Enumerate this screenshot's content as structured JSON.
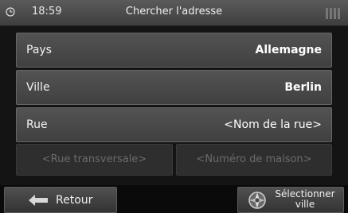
{
  "status": {
    "time": "18:59",
    "title": "Chercher l'adresse"
  },
  "fields": {
    "country": {
      "label": "Pays",
      "value": "Allemagne"
    },
    "city": {
      "label": "Ville",
      "value": "Berlin"
    },
    "street": {
      "label": "Rue",
      "value": "<Nom de la rue>"
    },
    "cross_street": {
      "placeholder": "<Rue transversale>"
    },
    "house_number": {
      "placeholder": "<Numéro de maison>"
    }
  },
  "bottom": {
    "back_label": "Retour",
    "select_city_line1": "Sélectionner",
    "select_city_line2": "ville"
  },
  "icons": {
    "clock": "clock-icon",
    "signal": "signal-icon",
    "back": "back-arrow-icon",
    "select": "compass-icon"
  }
}
